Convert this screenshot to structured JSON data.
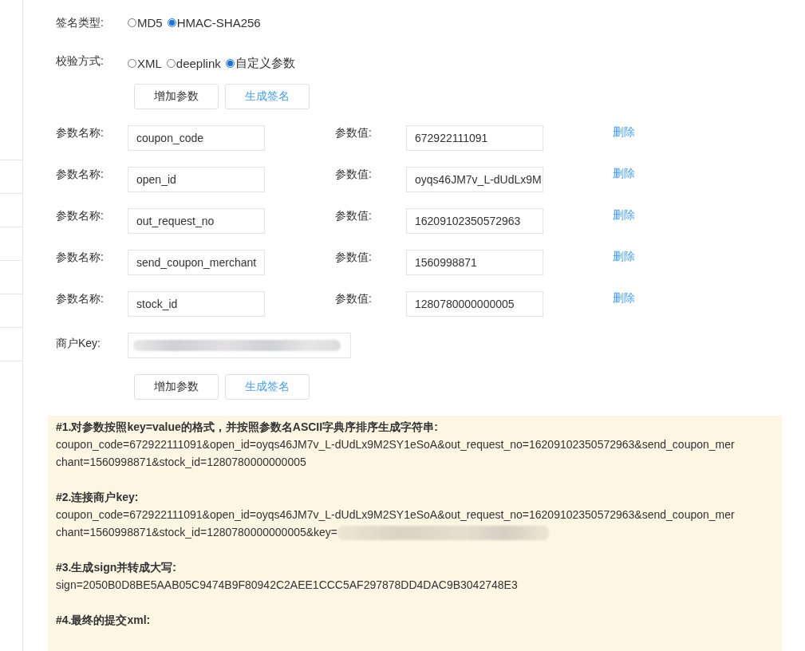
{
  "sign_type": {
    "label": "签名类型:",
    "options": [
      {
        "label": "MD5",
        "selected": false
      },
      {
        "label": "HMAC-SHA256",
        "selected": true
      }
    ]
  },
  "verify_mode": {
    "label": "校验方式:",
    "options": [
      {
        "label": "XML",
        "selected": false
      },
      {
        "label": "deeplink",
        "selected": false
      },
      {
        "label": "自定义参数",
        "selected": true
      }
    ]
  },
  "buttons_top": [
    {
      "label": "增加参数",
      "kind": "default"
    },
    {
      "label": "生成签名",
      "kind": "primary"
    }
  ],
  "params": [
    {
      "name_label": "参数名称:",
      "name": "coupon_code",
      "value_label": "参数值:",
      "value": "672922111091",
      "delete": "删除"
    },
    {
      "name_label": "参数名称:",
      "name": "open_id",
      "value_label": "参数值:",
      "value": "oyqs46JM7v_L-dUdLx9M",
      "delete": "删除"
    },
    {
      "name_label": "参数名称:",
      "name": "out_request_no",
      "value_label": "参数值:",
      "value": "16209102350572963",
      "delete": "删除"
    },
    {
      "name_label": "参数名称:",
      "name": "send_coupon_merchant",
      "value_label": "参数值:",
      "value": "1560998871",
      "delete": "删除"
    },
    {
      "name_label": "参数名称:",
      "name": "stock_id",
      "value_label": "参数值:",
      "value": "1280780000000005",
      "delete": "删除"
    }
  ],
  "merchant_key": {
    "label": "商户Key:"
  },
  "buttons_bottom": [
    {
      "label": "增加参数",
      "kind": "default"
    },
    {
      "label": "生成签名",
      "kind": "primary"
    }
  ],
  "steps": [
    {
      "heading": "#1.对参数按照key=value的格式，并按照参数名ASCII字典序排序生成字符串:",
      "lines": [
        "coupon_code=672922111091&open_id=oyqs46JM7v_L-dUdLx9M2SY1eSoA&out_request_no=16209102350572963&send_coupon_mer",
        "chant=1560998871&stock_id=1280780000000005"
      ]
    },
    {
      "heading": "#2.连接商户key:",
      "lines": [
        "coupon_code=672922111091&open_id=oyqs46JM7v_L-dUdLx9M2SY1eSoA&out_request_no=16209102350572963&send_coupon_mer",
        "chant=1560998871&stock_id=1280780000000005&key="
      ],
      "kind": "with_key"
    },
    {
      "heading": "#3.生成sign并转成大写:",
      "lines": [
        "sign=2050B0D8BE5AAB05C9474B9F80942C2AEE1CCC5AF297878DD4DAC9B3042748E3"
      ]
    },
    {
      "heading": "#4.最终的提交xml:"
    }
  ]
}
